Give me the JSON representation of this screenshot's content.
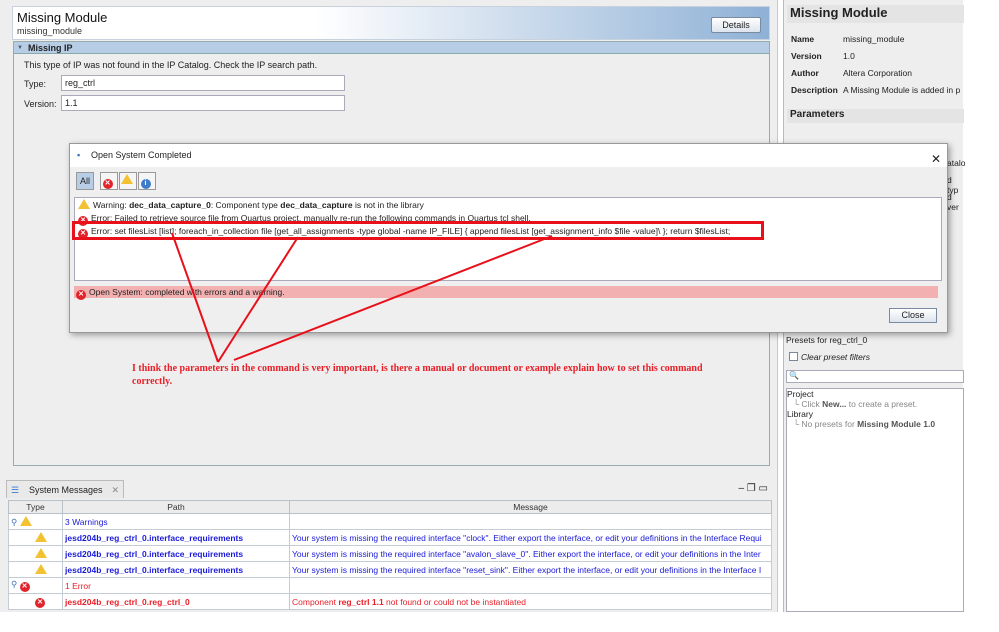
{
  "header": {
    "title": "Missing Module",
    "subtitle": "missing_module",
    "details_label": "Details"
  },
  "missing_ip": {
    "section": "Missing IP",
    "message": "This type of IP was not found in the IP Catalog. Check the IP search path.",
    "type_label": "Type:",
    "type_value": "reg_ctrl",
    "version_label": "Version:",
    "version_value": "1.1"
  },
  "right_panel": {
    "title": "Missing Module",
    "props": [
      {
        "k": "Name",
        "v": "missing_module"
      },
      {
        "k": "Version",
        "v": "1.0"
      },
      {
        "k": "Author",
        "v": "Altera Corporation"
      },
      {
        "k": "Description",
        "v": "A Missing Module is added in p"
      }
    ],
    "parameters": "Parameters",
    "partial": [
      "atalo",
      "d typ",
      "d ver"
    ],
    "presets_for": "Presets for reg_ctrl_0",
    "clear_filters": "Clear preset filters",
    "search_placeholder": "",
    "project": "Project",
    "project_hint_pre": "Click ",
    "project_hint_bold": "New...",
    "project_hint_post": " to create a preset.",
    "library": "Library",
    "library_hint_pre": "No presets for ",
    "library_hint_bold": "Missing Module 1.0"
  },
  "dialog": {
    "title": "Open System Completed",
    "filter_all": "All",
    "messages": [
      {
        "kind": "warning",
        "pre": "Warning: ",
        "b1": "dec_data_capture_0",
        "mid": ": Component type ",
        "b2": "dec_data_capture",
        "post": " is not in the library"
      },
      {
        "kind": "error",
        "text": "Error: Failed to retrieve source file from Quartus project, manually re-run the following commands in Quartus tcl shell."
      },
      {
        "kind": "error",
        "text": "Error: set filesList [list]; foreach_in_collection file [get_all_assignments -type global -name IP_FILE] { append filesList [get_assignment_info $file -value]\\ }; return $filesList;"
      }
    ],
    "status": "Open System: completed with errors and a warning.",
    "close_label": "Close"
  },
  "annotation": "I think the parameters in the command is very important, is there a manual or document or example explain how to set this command correctly.",
  "system_messages": {
    "tab": "System Messages",
    "columns": [
      "Type",
      "Path",
      "Message"
    ],
    "rows": [
      {
        "kind": "warn-group",
        "path": "3 Warnings",
        "msg": ""
      },
      {
        "kind": "warn",
        "path": "jesd204b_reg_ctrl_0.interface_requirements",
        "msg": "Your system is missing the required interface \"clock\". Either export the interface, or edit your definitions in the Interface Requi"
      },
      {
        "kind": "warn",
        "path": "jesd204b_reg_ctrl_0.interface_requirements",
        "msg": "Your system is missing the required interface \"avalon_slave_0\". Either export the interface, or edit your definitions in the Inter"
      },
      {
        "kind": "warn",
        "path": "jesd204b_reg_ctrl_0.interface_requirements",
        "msg": "Your system is missing the required interface \"reset_sink\". Either export the interface, or edit your definitions in the Interface I"
      },
      {
        "kind": "err-group",
        "path": "1 Error",
        "msg": ""
      },
      {
        "kind": "err",
        "path": "jesd204b_reg_ctrl_0.reg_ctrl_0",
        "msg_pre": "Component ",
        "msg_bold": "reg_ctrl 1.1",
        "msg_post": " not found or could not be instantiated"
      }
    ]
  }
}
